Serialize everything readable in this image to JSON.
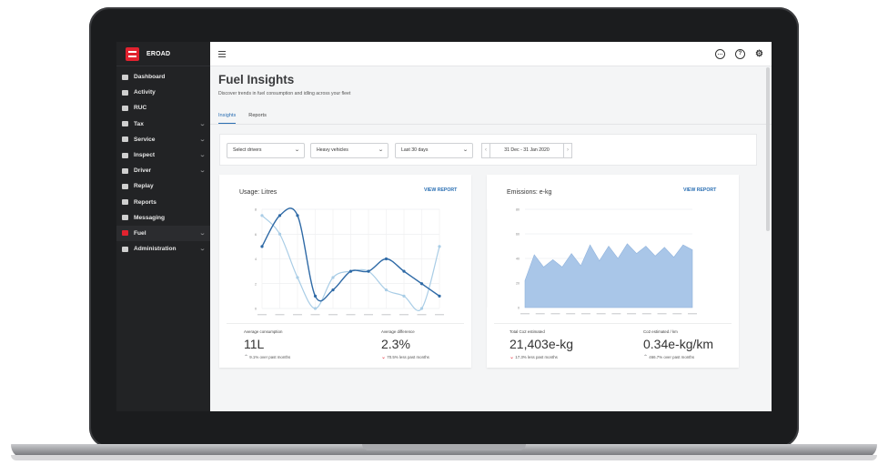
{
  "app": {
    "brand_name": "EROAD",
    "brand_color": "#e2222f",
    "accent_color": "#2a6fb3"
  },
  "sidebar": {
    "items": [
      {
        "label": "Dashboard",
        "icon": "dashboard-icon",
        "has_submenu": false,
        "active": false
      },
      {
        "label": "Activity",
        "icon": "activity-icon",
        "has_submenu": false,
        "active": false
      },
      {
        "label": "RUC",
        "icon": "ruc-icon",
        "has_submenu": false,
        "active": false
      },
      {
        "label": "Tax",
        "icon": "tax-icon",
        "has_submenu": true,
        "active": false
      },
      {
        "label": "Service",
        "icon": "service-icon",
        "has_submenu": true,
        "active": false
      },
      {
        "label": "Inspect",
        "icon": "inspect-icon",
        "has_submenu": true,
        "active": false
      },
      {
        "label": "Driver",
        "icon": "driver-icon",
        "has_submenu": true,
        "active": false
      },
      {
        "label": "Replay",
        "icon": "replay-icon",
        "has_submenu": false,
        "active": false
      },
      {
        "label": "Reports",
        "icon": "reports-icon",
        "has_submenu": false,
        "active": false
      },
      {
        "label": "Messaging",
        "icon": "messaging-icon",
        "has_submenu": false,
        "active": false
      },
      {
        "label": "Fuel",
        "icon": "fuel-icon",
        "has_submenu": true,
        "active": true
      },
      {
        "label": "Administration",
        "icon": "administration-icon",
        "has_submenu": true,
        "active": false
      }
    ]
  },
  "topbar": {
    "icons": [
      "menu-icon",
      "chat-icon",
      "help-icon",
      "settings-icon"
    ],
    "help_glyph": "?",
    "chat_glyph": "…",
    "settings_glyph": "⚙"
  },
  "page": {
    "title": "Fuel Insights",
    "subtitle": "Discover trends in fuel consumption and idling across your fleet",
    "tabs": [
      {
        "label": "Insights",
        "active": true
      },
      {
        "label": "Reports",
        "active": false
      }
    ]
  },
  "filters": {
    "drivers": "Select drivers",
    "vehicles": "Heavy vehicles",
    "period": "Last 30 days",
    "date_range": "31 Dec - 31 Jan 2020",
    "prev_glyph": "‹",
    "next_glyph": "›"
  },
  "cards": {
    "usage": {
      "title": "Usage: Litres",
      "view_report": "VIEW REPORT",
      "metrics": [
        {
          "label": "Average consumption",
          "value": "11L",
          "note": "9.1% over past months",
          "trend": "up"
        },
        {
          "label": "Average difference",
          "value": "2.3%",
          "note": "70.5% less past months",
          "trend": "down"
        }
      ]
    },
    "emissions": {
      "title": "Emissions: e-kg",
      "view_report": "VIEW REPORT",
      "metrics": [
        {
          "label": "Total Co2 estimated",
          "value": "21,403e-kg",
          "note": "17.3% less past months",
          "trend": "down"
        },
        {
          "label": "Co2 estimated / km",
          "value": "0.34e-kg/km",
          "note": "466.7% over past months",
          "trend": "up"
        }
      ]
    }
  },
  "chart_data": [
    {
      "type": "line",
      "title": "Usage: Litres",
      "ylim": [
        0,
        8
      ],
      "yticks": [
        "8",
        "6",
        "4",
        "2",
        "0"
      ],
      "series": [
        {
          "values": [
            5,
            7.5,
            7.5,
            1,
            1.5,
            3,
            3,
            4,
            3,
            2,
            1
          ]
        },
        {
          "values": [
            7.5,
            6,
            2.5,
            0,
            2.5,
            3,
            3,
            1.5,
            1,
            0,
            5
          ]
        }
      ],
      "colors": [
        "#2f6aa6",
        "#a9cde6"
      ],
      "grid": true
    },
    {
      "type": "area",
      "title": "Emissions: e-kg",
      "ylim": [
        0,
        80
      ],
      "yticks": [
        "80",
        "60",
        "40",
        "20",
        "0"
      ],
      "values": [
        22,
        43,
        33,
        39,
        33,
        44,
        34,
        51,
        38,
        50,
        40,
        52,
        44,
        50,
        42,
        49,
        41,
        51,
        47
      ],
      "color": "#a9c6e8",
      "grid": true
    }
  ]
}
